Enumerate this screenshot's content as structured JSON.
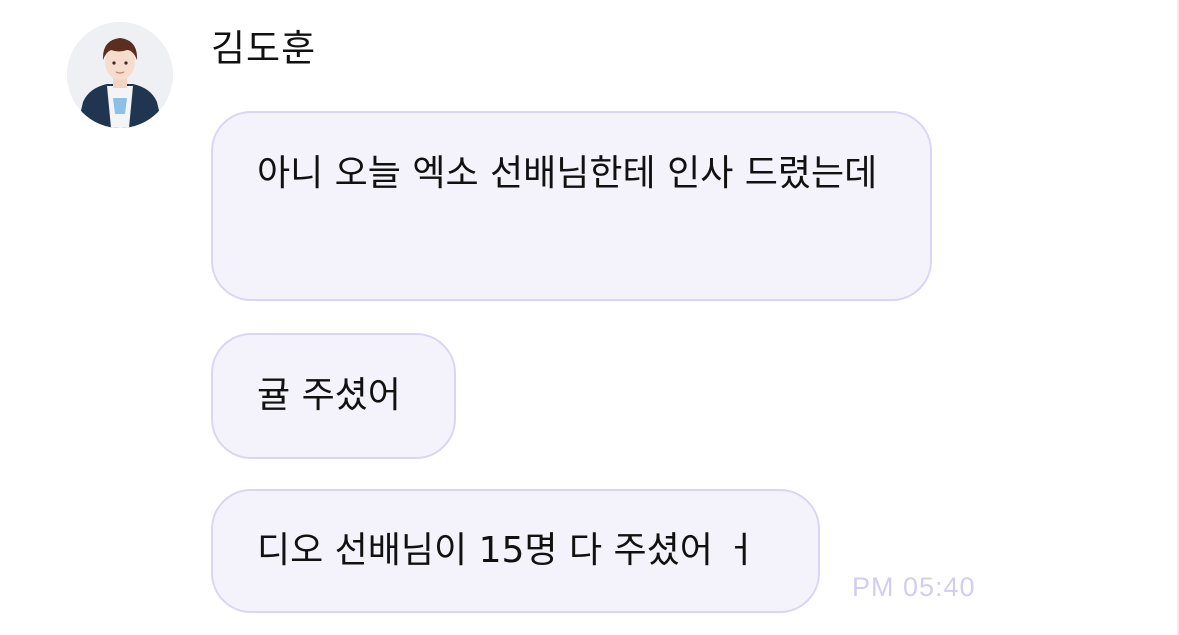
{
  "sender": {
    "name": "김도훈"
  },
  "messages": [
    {
      "text": "아니 오늘 엑소 선배님한테 인사 드렸는데"
    },
    {
      "text": "귤 주셨어"
    },
    {
      "text": "디오 선배님이 15명 다 주셨어 ㅓ"
    }
  ],
  "timestamp": "PM 05:40",
  "colors": {
    "bubble_background": "#f4f2fb",
    "bubble_border": "#dcd4f4",
    "timestamp": "#d3cdf2",
    "text": "#111111"
  },
  "icons": {
    "avatar": "profile-photo"
  }
}
